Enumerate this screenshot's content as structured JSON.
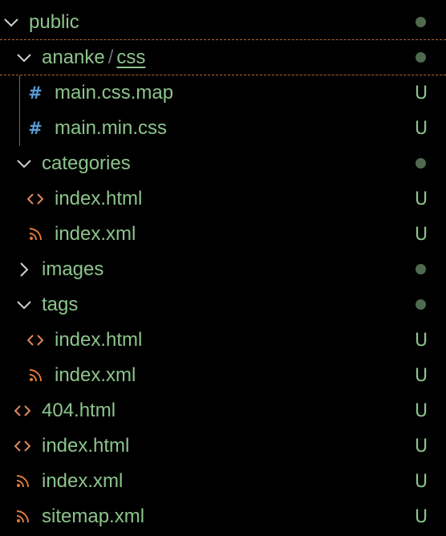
{
  "explorer": {
    "public": {
      "label": "public",
      "status": "●"
    },
    "ananke_css": {
      "folder": "ananke",
      "separator": "/",
      "subfolder": "css",
      "status": "●"
    },
    "main_css_map": {
      "label": "main.css.map",
      "status": "U",
      "icon": "hash"
    },
    "main_min_css": {
      "label": "main.min.css",
      "status": "U",
      "icon": "hash"
    },
    "categories": {
      "label": "categories",
      "status": "●"
    },
    "categories_index_html": {
      "label": "index.html",
      "status": "U",
      "icon": "code-brackets"
    },
    "categories_index_xml": {
      "label": "index.xml",
      "status": "U",
      "icon": "rss"
    },
    "images": {
      "label": "images",
      "status": "●"
    },
    "tags": {
      "label": "tags",
      "status": "●"
    },
    "tags_index_html": {
      "label": "index.html",
      "status": "U",
      "icon": "code-brackets"
    },
    "tags_index_xml": {
      "label": "index.xml",
      "status": "U",
      "icon": "rss"
    },
    "root_404_html": {
      "label": "404.html",
      "status": "U",
      "icon": "code-brackets"
    },
    "root_index_html": {
      "label": "index.html",
      "status": "U",
      "icon": "code-brackets"
    },
    "root_index_xml": {
      "label": "index.xml",
      "status": "U",
      "icon": "rss"
    },
    "root_sitemap_xml": {
      "label": "sitemap.xml",
      "status": "U",
      "icon": "rss"
    }
  },
  "colors": {
    "background": "#000000",
    "label_untracked": "#8cc48c",
    "status_dot": "#4f6a4f",
    "chevron": "#d0d0d0",
    "html_icon": "#e0895a",
    "rss_icon": "#e07a3a",
    "css_icon": "#5b9bd5",
    "sticky_border": "#b5683a"
  }
}
